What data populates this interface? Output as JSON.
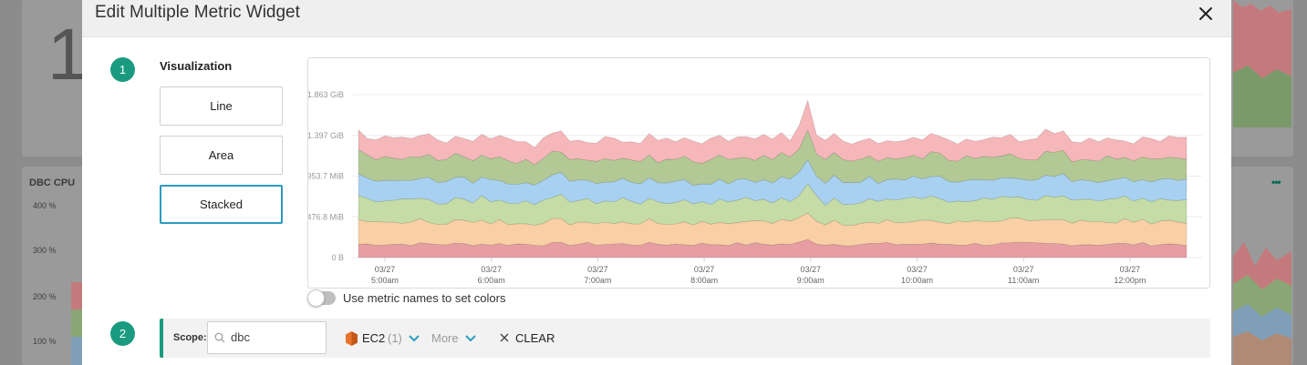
{
  "background": {
    "big_number": "1",
    "widget_title": "DBC CPU",
    "y_ticks": [
      "400 %",
      "300 %",
      "200 %",
      "100 %"
    ],
    "more_icon": "ellipsis-icon"
  },
  "modal": {
    "title": "Edit Multiple Metric Widget",
    "close_icon": "close-icon"
  },
  "visualization": {
    "step": "1",
    "label": "Visualization",
    "options": [
      "Line",
      "Area",
      "Stacked"
    ],
    "selected": "Stacked"
  },
  "toggle": {
    "label": "Use metric names to set colors",
    "on": false
  },
  "scope": {
    "step": "2",
    "label": "Scope:",
    "input_value": "dbc",
    "service_icon": "ec2-icon",
    "service": "EC2",
    "service_count": "(1)",
    "more": "More",
    "clear": "CLEAR"
  },
  "colors": {
    "accent": "#1a9b7f",
    "selected_border": "#2b9cc2",
    "chevron": "#2b9cc2",
    "ec2_orange": "#e8732a"
  },
  "chart_data": {
    "type": "area",
    "stacked": true,
    "title": "",
    "xlabel": "",
    "ylabel": "",
    "y_ticks": [
      "0 B",
      "476.8 MiB",
      "953.7 MiB",
      "1.397 GiB",
      "1.863 GiB"
    ],
    "x_ticks": [
      {
        "date": "03/27",
        "time": "5:00am"
      },
      {
        "date": "03/27",
        "time": "6:00am"
      },
      {
        "date": "03/27",
        "time": "7:00am"
      },
      {
        "date": "03/27",
        "time": "8:00am"
      },
      {
        "date": "03/27",
        "time": "9:00am"
      },
      {
        "date": "03/27",
        "time": "10:00am"
      },
      {
        "date": "03/27",
        "time": "11:00am"
      },
      {
        "date": "03/27",
        "time": "12:00pm"
      }
    ],
    "ylim_mib": [
      0,
      1908
    ],
    "grid": true,
    "legend": "none",
    "series_colors": [
      "#e79ea3",
      "#f9cfa5",
      "#c5dca6",
      "#a8d1f1",
      "#b3c995",
      "#f5b7ba"
    ],
    "series_mid_mib": [
      158,
      262,
      258,
      238,
      262,
      227
    ],
    "series_amplitude_mib": [
      22,
      28,
      32,
      28,
      30,
      38
    ],
    "spike_at_time": "9:00am"
  }
}
